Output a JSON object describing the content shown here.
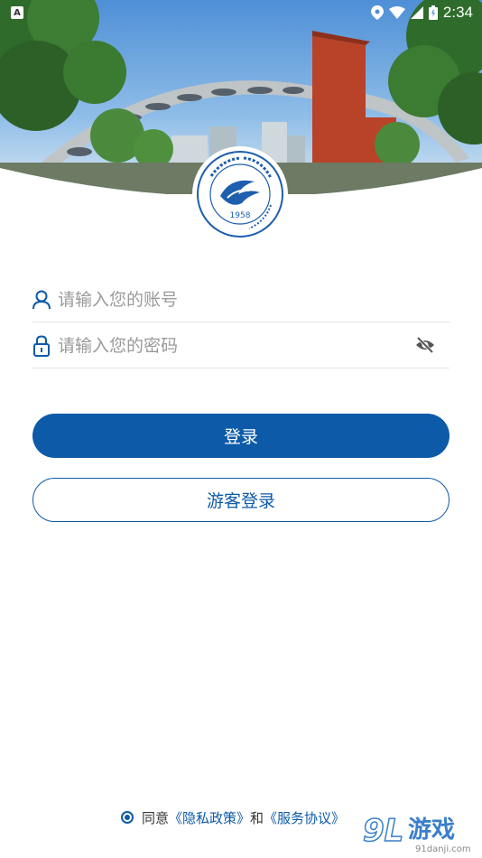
{
  "status_bar": {
    "time": "2:34",
    "notification_letter": "A"
  },
  "emblem": {
    "year": "1958"
  },
  "login": {
    "account_placeholder": "请输入您的账号",
    "password_placeholder": "请输入您的密码",
    "login_button": "登录",
    "guest_button": "游客登录"
  },
  "agreement": {
    "prefix": "同意",
    "privacy_link": "《隐私政策》",
    "conjunction": "和",
    "service_link": "《服务协议》"
  },
  "watermark": {
    "logo_text": "9L游戏",
    "site": "91danji.com"
  },
  "colors": {
    "primary": "#0d5aa8",
    "placeholder": "#9a9a9a",
    "divider": "#e5e5e5"
  }
}
